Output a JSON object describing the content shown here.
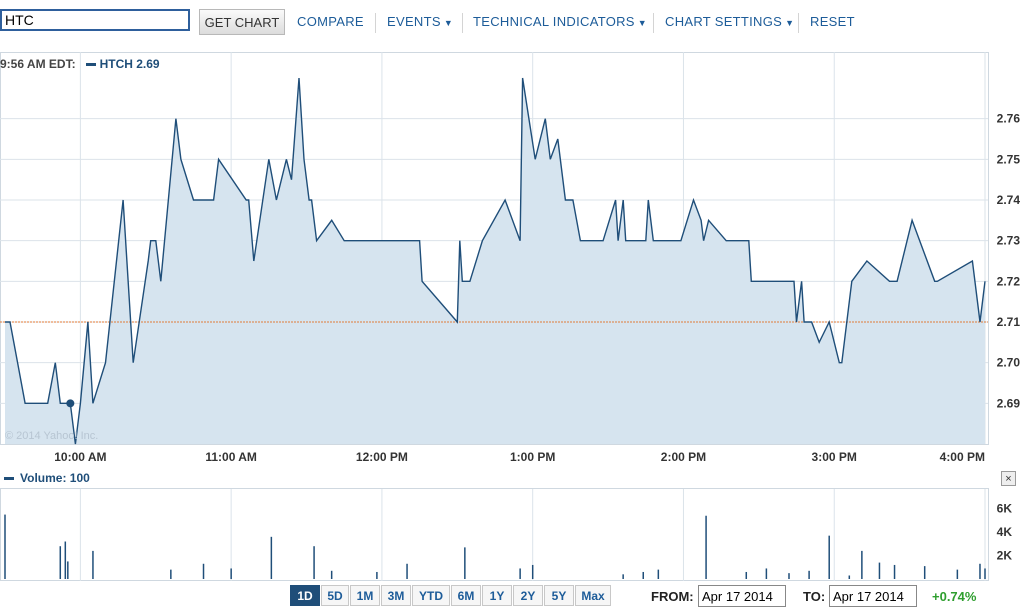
{
  "toolbar": {
    "symbol_value": "HTC",
    "get_chart_label": "GET CHART",
    "compare_label": "COMPARE",
    "events_label": "EVENTS",
    "technical_label": "TECHNICAL INDICATORS",
    "settings_label": "CHART SETTINGS",
    "reset_label": "RESET"
  },
  "price_panel": {
    "time_label": "9:56 AM EDT:",
    "symbol_label": "HTCH 2.69",
    "watermark": "© 2014 Yahoo! Inc."
  },
  "volume_panel": {
    "label": "Volume: 100",
    "close_label": "×"
  },
  "ranges": [
    "1D",
    "5D",
    "1M",
    "3M",
    "YTD",
    "6M",
    "1Y",
    "2Y",
    "5Y",
    "Max"
  ],
  "active_range": "1D",
  "dates": {
    "from_label": "FROM:",
    "from_value": "Apr 17 2014",
    "to_label": "TO:",
    "to_value": "Apr 17 2014"
  },
  "change": {
    "text": "+0.74%",
    "color": "#2e9e2e"
  },
  "colors": {
    "line": "#1f4e79",
    "fill": "#d6e4ef",
    "grid": "#dbe3ea",
    "baseline": "#e07b39"
  },
  "chart_data": [
    {
      "type": "area",
      "title": "",
      "series": [
        {
          "name": "HTCH",
          "x_minutes_from_open": [],
          "values": []
        }
      ],
      "x": [
        "9:30",
        "9:32",
        "9:35",
        "9:38",
        "9:45",
        "9:47",
        "9:50",
        "9:52",
        "9:56",
        "9:58",
        "10:00",
        "10:03",
        "10:05",
        "10:10",
        "10:17",
        "10:21",
        "10:27",
        "10:28",
        "10:30",
        "10:32",
        "10:38",
        "10:40",
        "10:45",
        "10:53",
        "10:55",
        "11:06",
        "11:07",
        "11:09",
        "11:15",
        "11:18",
        "11:22",
        "11:24",
        "11:27",
        "11:29",
        "11:31",
        "11:32",
        "11:34",
        "11:40",
        "11:45",
        "11:49",
        "11:50",
        "12:15",
        "12:16",
        "12:30",
        "12:31",
        "12:32",
        "12:35",
        "12:40",
        "12:49",
        "12:55",
        "12:56",
        "13:01",
        "13:05",
        "13:07",
        "13:10",
        "13:13",
        "13:16",
        "13:19",
        "13:28",
        "13:33",
        "13:34",
        "13:36",
        "13:37",
        "13:45",
        "13:46",
        "13:48",
        "13:59",
        "14:04",
        "14:07",
        "14:08",
        "14:10",
        "14:17",
        "14:26",
        "14:27",
        "14:44",
        "14:45",
        "14:47",
        "14:48",
        "14:51",
        "14:54",
        "14:58",
        "15:02",
        "15:03",
        "15:07",
        "15:13",
        "15:22",
        "15:25",
        "15:31",
        "15:40",
        "15:41",
        "15:55",
        "15:58",
        "16:00"
      ],
      "values": [
        2.71,
        2.71,
        2.7,
        2.69,
        2.69,
        2.69,
        2.7,
        2.69,
        2.69,
        2.68,
        2.69,
        2.71,
        2.69,
        2.7,
        2.74,
        2.7,
        2.725,
        2.73,
        2.73,
        2.72,
        2.76,
        2.75,
        2.74,
        2.74,
        2.75,
        2.74,
        2.74,
        2.725,
        2.75,
        2.74,
        2.75,
        2.745,
        2.77,
        2.75,
        2.74,
        2.74,
        2.73,
        2.735,
        2.73,
        2.73,
        2.73,
        2.73,
        2.72,
        2.71,
        2.73,
        2.72,
        2.72,
        2.73,
        2.74,
        2.73,
        2.77,
        2.75,
        2.76,
        2.75,
        2.755,
        2.74,
        2.74,
        2.73,
        2.73,
        2.74,
        2.73,
        2.74,
        2.73,
        2.73,
        2.74,
        2.73,
        2.73,
        2.74,
        2.735,
        2.73,
        2.735,
        2.73,
        2.73,
        2.72,
        2.72,
        2.71,
        2.72,
        2.71,
        2.71,
        2.705,
        2.71,
        2.7,
        2.7,
        2.72,
        2.725,
        2.72,
        2.72,
        2.735,
        2.72,
        2.72,
        2.725,
        2.71,
        2.72
      ],
      "x_ticks": [
        "10:00 AM",
        "11:00 AM",
        "12:00 PM",
        "1:00 PM",
        "2:00 PM",
        "3:00 PM",
        "4:00 PM"
      ],
      "y_ticks": [
        2.69,
        2.7,
        2.71,
        2.72,
        2.73,
        2.74,
        2.75,
        2.76
      ],
      "ylim": [
        2.68,
        2.77
      ],
      "previous_close": 2.71,
      "marker": {
        "x": "9:56",
        "value": 2.69
      },
      "grid": true
    },
    {
      "type": "bar",
      "title": "",
      "series": [
        {
          "name": "Volume",
          "x": [
            "9:30",
            "9:52",
            "9:54",
            "9:55",
            "10:05",
            "10:36",
            "10:49",
            "11:00",
            "11:16",
            "11:33",
            "11:40",
            "11:58",
            "12:10",
            "12:33",
            "12:55",
            "13:00",
            "13:36",
            "13:44",
            "13:50",
            "14:09",
            "14:25",
            "14:33",
            "14:42",
            "14:50",
            "14:58",
            "15:06",
            "15:11",
            "15:18",
            "15:24",
            "15:36",
            "15:49",
            "15:58",
            "16:00"
          ],
          "values": [
            5500,
            2800,
            3200,
            1500,
            2400,
            800,
            1300,
            900,
            3600,
            2800,
            700,
            600,
            1300,
            2700,
            900,
            1200,
            400,
            600,
            800,
            5400,
            600,
            900,
            500,
            700,
            3700,
            300,
            2400,
            1400,
            1200,
            1100,
            800,
            1300,
            900
          ]
        }
      ],
      "y_ticks": [
        "2K",
        "4K",
        "6K"
      ],
      "y_tick_values": [
        2000,
        4000,
        6000
      ],
      "ylim": [
        0,
        7000
      ]
    }
  ]
}
